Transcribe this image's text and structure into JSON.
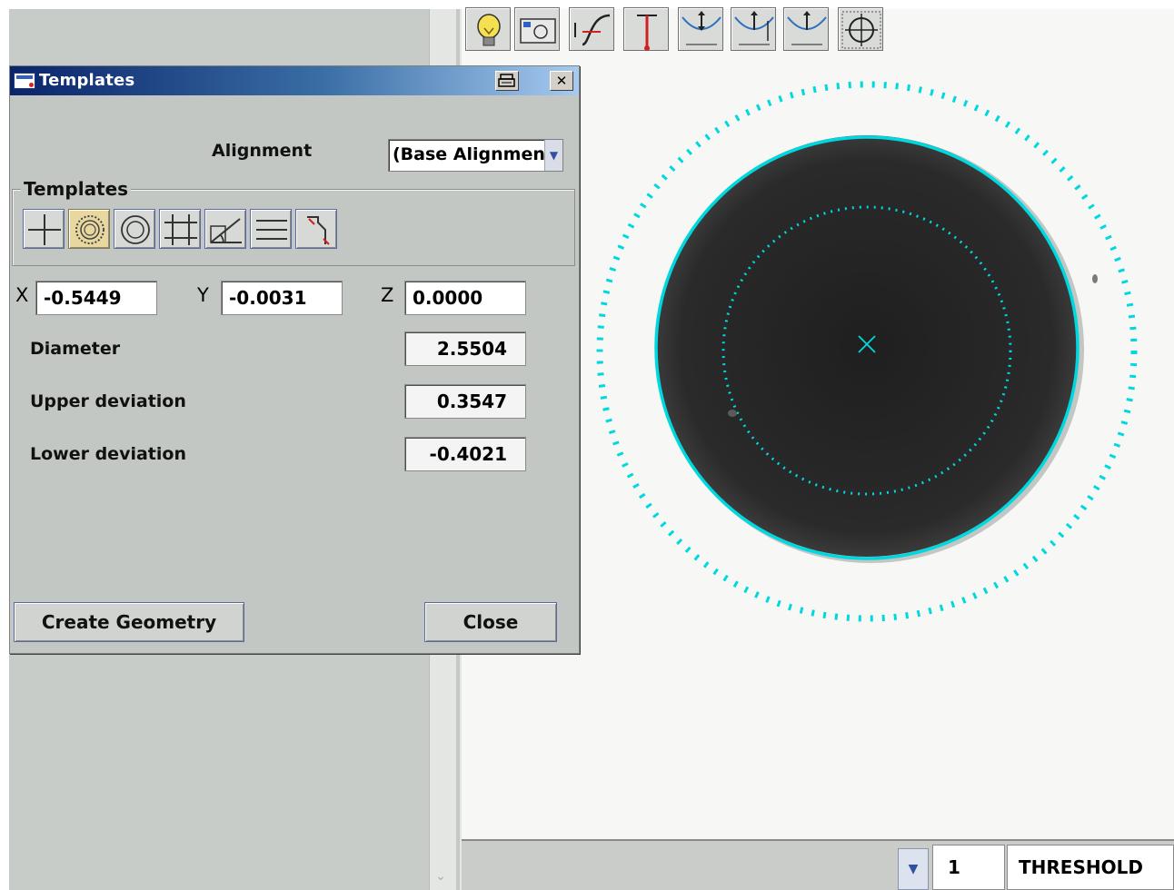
{
  "dialog": {
    "title": "Templates",
    "alignment_label": "Alignment",
    "alignment_value": "(Base Alignment)",
    "templates_group_label": "Templates",
    "template_icons": [
      "crosshair-point-icon",
      "circle-fit-icon",
      "concentric-circles-icon",
      "grid-lines-icon",
      "angle-arc-icon",
      "parallel-lines-icon",
      "arc-path-icon"
    ],
    "active_template_index": 1,
    "x_label": "X",
    "x_value": "-0.5449",
    "y_label": "Y",
    "y_value": "-0.0031",
    "z_label": "Z",
    "z_value": "0.0000",
    "diameter_label": "Diameter",
    "diameter_value": "2.5504",
    "upper_dev_label": "Upper deviation",
    "upper_dev_value": "0.3547",
    "lower_dev_label": "Lower deviation",
    "lower_dev_value": "-0.4021",
    "create_button": "Create Geometry",
    "close_button": "Close"
  },
  "toolbar": {
    "tools": [
      "light-bulb-icon",
      "camera-icon",
      "edge-profile-icon",
      "height-gauge-icon",
      "focus-af-icon",
      "focus-z-icon",
      "focus-f-icon",
      "target-crosshair-icon"
    ],
    "count_value": "1",
    "mode_value": "THRESHOLD"
  },
  "colors": {
    "overlay": "#00d8e0",
    "part": "#262626",
    "titlebar_start": "#0a246a",
    "titlebar_end": "#a6caf0"
  }
}
